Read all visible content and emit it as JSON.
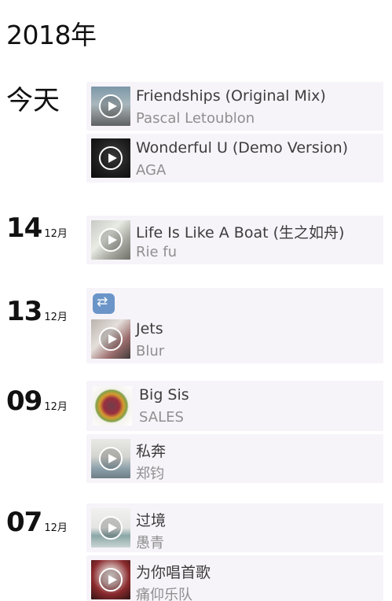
{
  "year": "2018年",
  "days": [
    {
      "label": "今天",
      "month": ""
    },
    {
      "label": "14",
      "month": "12月"
    },
    {
      "label": "13",
      "month": "12月"
    },
    {
      "label": "09",
      "month": "12月"
    },
    {
      "label": "07",
      "month": "12月"
    }
  ],
  "tracks": [
    {
      "title": "Friendships (Original Mix)",
      "artist": "Pascal Letoublon"
    },
    {
      "title": "Wonderful U (Demo Version)",
      "artist": "AGA"
    },
    {
      "title": "Life Is Like A Boat (生之如舟)",
      "artist": "Rie fu"
    },
    {
      "title": "Jets",
      "artist": "Blur"
    },
    {
      "title": "Big Sis",
      "artist": "SALES"
    },
    {
      "title": "私奔",
      "artist": "郑钧"
    },
    {
      "title": "过境",
      "artist": "愚青"
    },
    {
      "title": "为你唱首歌",
      "artist": "痛仰乐队"
    }
  ],
  "icons": {
    "play": "play-icon",
    "repeat": "repeat-icon"
  }
}
